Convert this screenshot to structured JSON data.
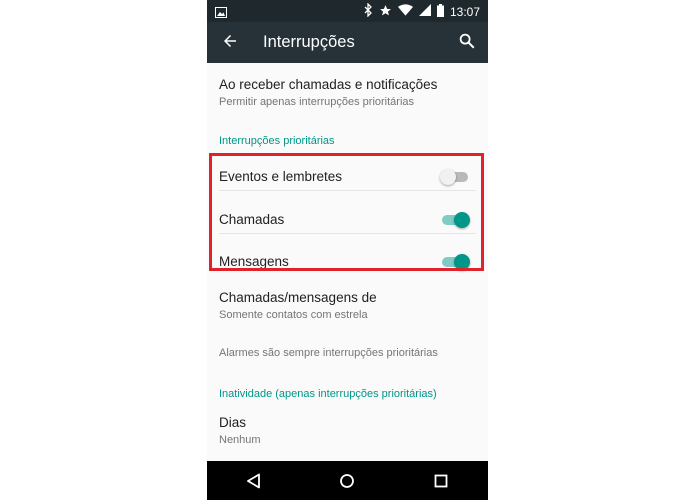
{
  "status_bar": {
    "time": "13:07",
    "left_icons": [
      "image-icon"
    ],
    "right_icons": [
      "bluetooth-icon",
      "star-icon",
      "wifi-icon",
      "signal-icon",
      "battery-icon"
    ]
  },
  "toolbar": {
    "title": "Interrupções",
    "back_icon": "arrow-left-icon",
    "search_icon": "search-icon"
  },
  "settings": {
    "calls_notifications": {
      "title": "Ao receber chamadas e notificações",
      "subtitle": "Permitir apenas interrupções prioritárias"
    },
    "priority_header": "Interrupções prioritárias",
    "toggles": [
      {
        "label": "Eventos e lembretes",
        "on": false
      },
      {
        "label": "Chamadas",
        "on": true
      },
      {
        "label": "Mensagens",
        "on": true
      }
    ],
    "calls_messages_from": {
      "title": "Chamadas/mensagens de",
      "subtitle": "Somente contatos com estrela"
    },
    "alarms_note": "Alarmes são sempre interrupções prioritárias",
    "downtime_header": "Inatividade (apenas interrupções prioritárias)",
    "days": {
      "title": "Dias",
      "subtitle": "Nenhum"
    }
  },
  "nav_bar": {
    "icons": [
      "back-triangle-icon",
      "home-circle-icon",
      "recents-square-icon"
    ]
  },
  "colors": {
    "accent": "#009688",
    "toolbar": "#263238",
    "statusbar": "#1f292d",
    "highlight_border": "#e0232b"
  }
}
